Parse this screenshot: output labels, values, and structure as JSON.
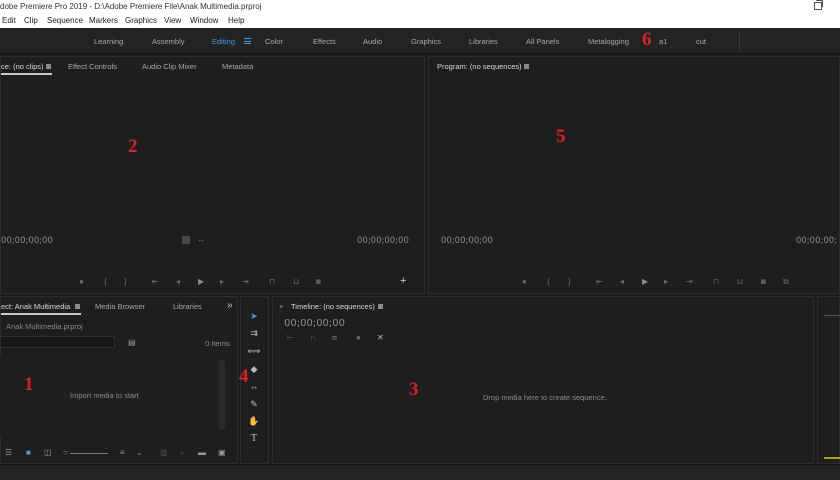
{
  "window": {
    "title": "dobe Premiere Pro 2019 - D:\\Adobe Premiere File\\Anak Multimedia.prproj"
  },
  "menubar": {
    "items": [
      "Edit",
      "Clip",
      "Sequence",
      "Markers",
      "Graphics",
      "View",
      "Window",
      "Help"
    ]
  },
  "workspaces": {
    "items": [
      "Learning",
      "Assembly",
      "Editing",
      "Color",
      "Effects",
      "Audio",
      "Graphics",
      "Libraries",
      "All Panels",
      "Metalogging",
      "a1",
      "cut"
    ],
    "active": "Editing"
  },
  "source_panel": {
    "tabs": [
      "ce: (no clips)",
      "Effect Controls",
      "Audio Clip Mixer",
      "Metadata"
    ],
    "timecode_left": "00;00;00;00",
    "timecode_right": "00;00;00;00"
  },
  "program_panel": {
    "tab": "Program: (no sequences)",
    "timecode_left": "00;00;00;00",
    "timecode_right": "00;00;00;"
  },
  "project_panel": {
    "tabs": [
      "ect: Anak Multimedia",
      "Media Browser",
      "Libraries"
    ],
    "overflow": "»",
    "file": "Anak Multimedia.prproj",
    "items_count": "0 Items",
    "empty_message": "Import media to start"
  },
  "timeline_panel": {
    "close": "×",
    "tab": "Timeline: (no sequences)",
    "timecode": "00;00;00;00",
    "empty_message": "Drop media here to create sequence."
  },
  "annotations": {
    "n1": "1",
    "n2": "2",
    "n3": "3",
    "n4": "4",
    "n5": "5",
    "n6": "6"
  },
  "colors": {
    "accent": "#3e9ae8",
    "annotation": "#e0201f",
    "background": "#1d1d1d"
  }
}
